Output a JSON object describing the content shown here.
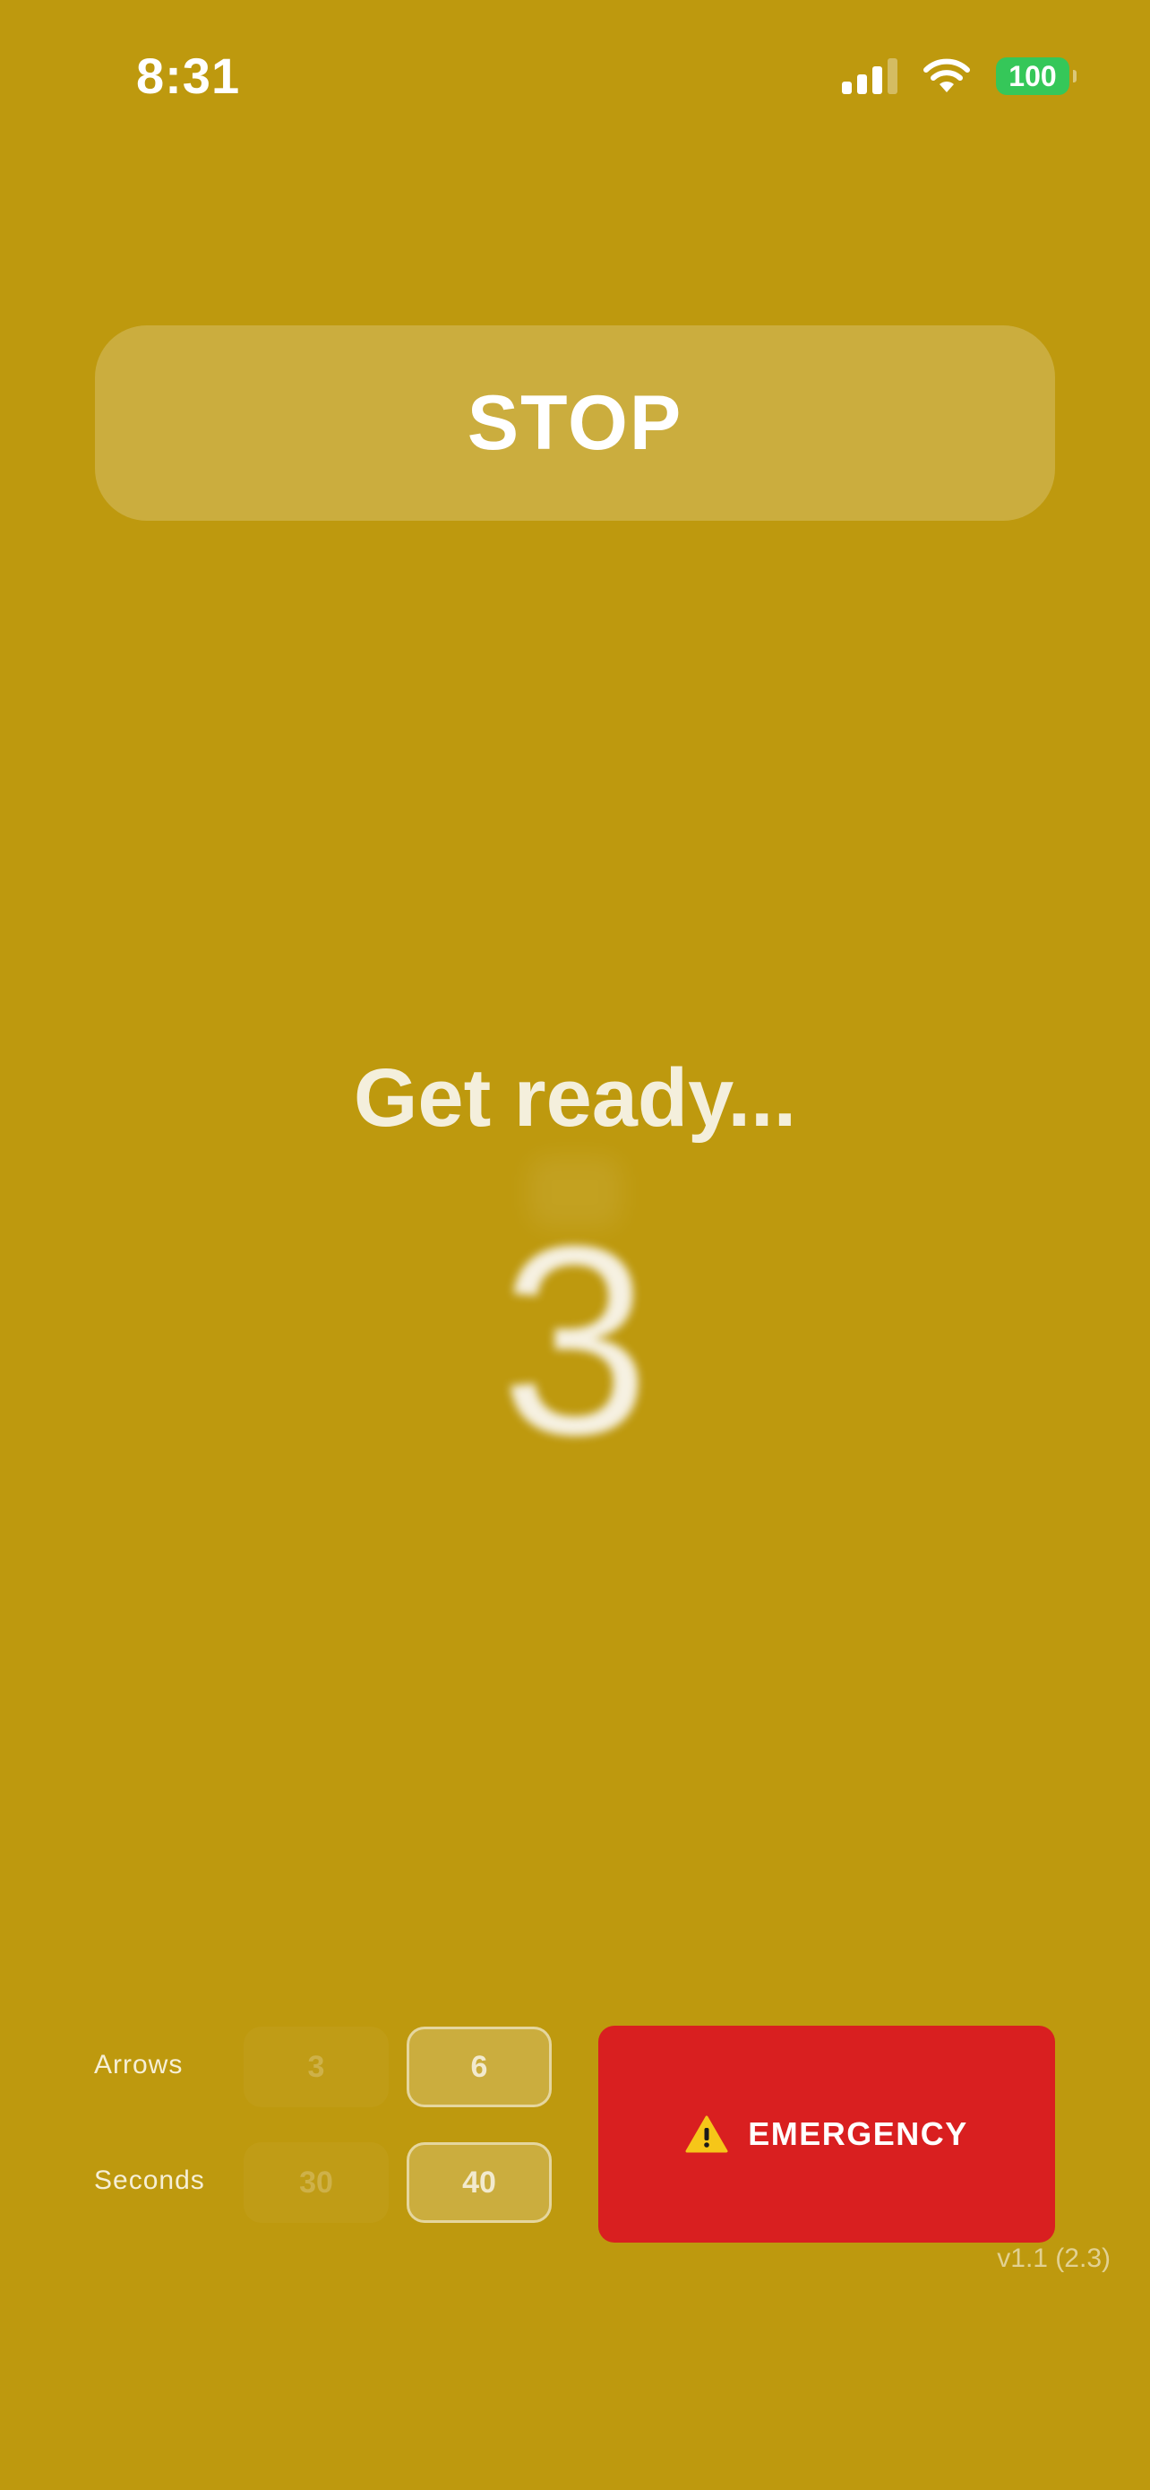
{
  "status_bar": {
    "time": "8:31",
    "battery": "100",
    "battery_color": "#35C759",
    "icons": [
      "cellular-signal-icon",
      "wifi-icon",
      "battery-icon"
    ]
  },
  "stop_button": {
    "label": "STOP"
  },
  "countdown": {
    "prompt": "Get ready...",
    "number": "3"
  },
  "settings": {
    "arrows": {
      "label": "Arrows",
      "options": [
        "3",
        "6"
      ],
      "selected": "6"
    },
    "seconds": {
      "label": "Seconds",
      "options": [
        "30",
        "40"
      ],
      "selected": "40"
    }
  },
  "emergency_button": {
    "label": "EMERGENCY",
    "icon": "warning-icon",
    "color": "#D91F20"
  },
  "version": "v1.1 (2.3)",
  "theme": {
    "background": "#BE990E"
  }
}
